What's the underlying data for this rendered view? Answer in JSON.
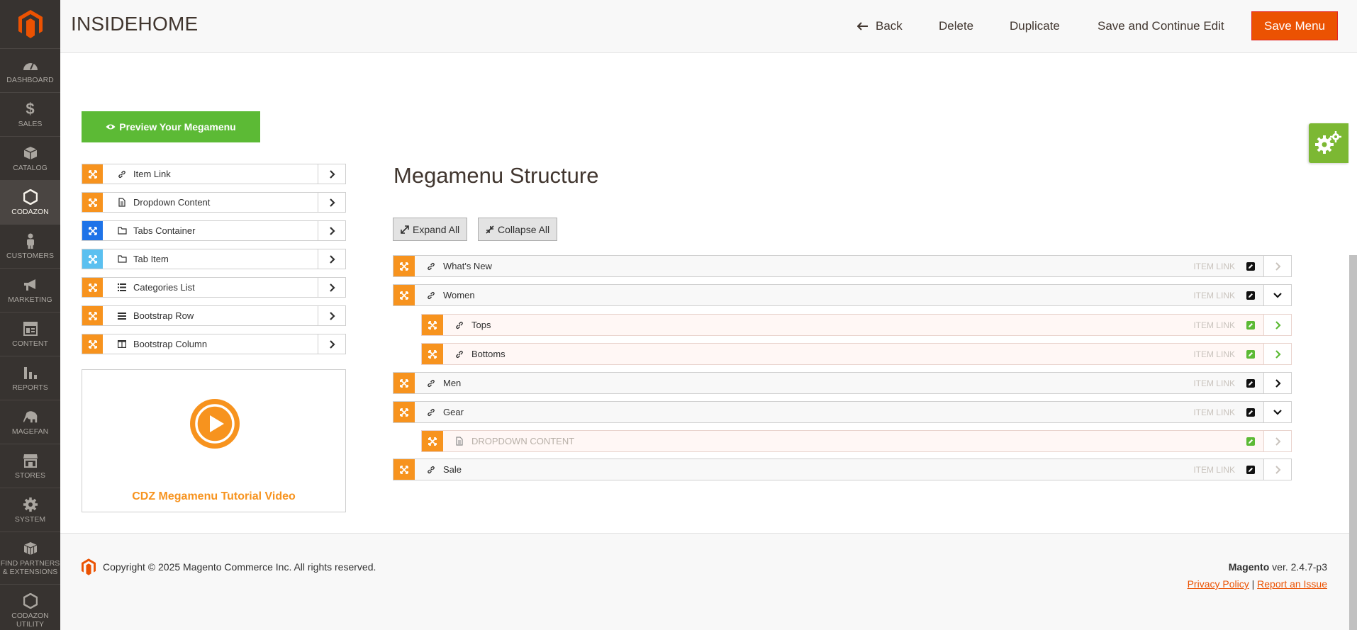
{
  "sidebar": {
    "items": [
      {
        "label": "DASHBOARD",
        "icon": "dashboard-icon"
      },
      {
        "label": "SALES",
        "icon": "dollar-icon"
      },
      {
        "label": "CATALOG",
        "icon": "box-icon"
      },
      {
        "label": "CODAZON",
        "icon": "hexagon-icon"
      },
      {
        "label": "CUSTOMERS",
        "icon": "person-icon"
      },
      {
        "label": "MARKETING",
        "icon": "megaphone-icon"
      },
      {
        "label": "CONTENT",
        "icon": "layout-icon"
      },
      {
        "label": "REPORTS",
        "icon": "bar-chart-icon"
      },
      {
        "label": "MAGEFAN",
        "icon": "elephant-icon"
      },
      {
        "label": "STORES",
        "icon": "store-icon"
      },
      {
        "label": "SYSTEM",
        "icon": "gear-icon"
      },
      {
        "label": "FIND PARTNERS & EXTENSIONS",
        "icon": "cubes-icon"
      },
      {
        "label": "CODAZON UTILITY",
        "icon": "hexagon-icon"
      }
    ]
  },
  "header": {
    "title": "INSIDEHOME",
    "back_label": "Back",
    "delete_label": "Delete",
    "duplicate_label": "Duplicate",
    "save_continue_label": "Save and Continue Edit",
    "save_menu_label": "Save Menu"
  },
  "preview_label": "Preview Your Megamenu",
  "palette": [
    {
      "label": "Item Link",
      "handle_color": "#f7931e",
      "icon": "link-icon"
    },
    {
      "label": "Dropdown Content",
      "handle_color": "#f7931e",
      "icon": "document-icon"
    },
    {
      "label": "Tabs Container",
      "handle_color": "#1e73e8",
      "icon": "folder-icon"
    },
    {
      "label": "Tab Item",
      "handle_color": "#5bc0f0",
      "icon": "folder-icon"
    },
    {
      "label": "Categories List",
      "handle_color": "#f7931e",
      "icon": "list-icon"
    },
    {
      "label": "Bootstrap Row",
      "handle_color": "#f7931e",
      "icon": "bars-icon"
    },
    {
      "label": "Bootstrap Column",
      "handle_color": "#f7931e",
      "icon": "columns-icon"
    }
  ],
  "video": {
    "title": "CDZ Megamenu Tutorial Video"
  },
  "structure": {
    "title": "Megamenu Structure",
    "expand_label": "Expand All",
    "collapse_label": "Collapse All",
    "items": [
      {
        "label": "What's New",
        "type": "ITEM LINK",
        "arrow": "right-muted",
        "child": false
      },
      {
        "label": "Women",
        "type": "ITEM LINK",
        "arrow": "down",
        "child": false
      },
      {
        "label": "Tops",
        "type": "ITEM LINK",
        "arrow": "right-green",
        "child": true
      },
      {
        "label": "Bottoms",
        "type": "ITEM LINK",
        "arrow": "right-green",
        "child": true
      },
      {
        "label": "Men",
        "type": "ITEM LINK",
        "arrow": "right",
        "child": false
      },
      {
        "label": "Gear",
        "type": "ITEM LINK",
        "arrow": "down",
        "child": false
      },
      {
        "label": "DROPDOWN CONTENT",
        "type": "",
        "arrow": "right-muted",
        "child": true
      },
      {
        "label": "Sale",
        "type": "ITEM LINK",
        "arrow": "right-muted",
        "child": false
      }
    ]
  },
  "footer": {
    "copyright": "Copyright © 2025 Magento Commerce Inc. All rights reserved.",
    "brand": "Magento",
    "version": " ver. 2.4.7-p3",
    "privacy_label": "Privacy Policy",
    "separator": " | ",
    "report_label": "Report an Issue"
  },
  "colors": {
    "accent": "#eb5202",
    "handle_orange": "#f7931e",
    "preview_green": "#5cba35",
    "sidebar_bg": "#373330"
  }
}
